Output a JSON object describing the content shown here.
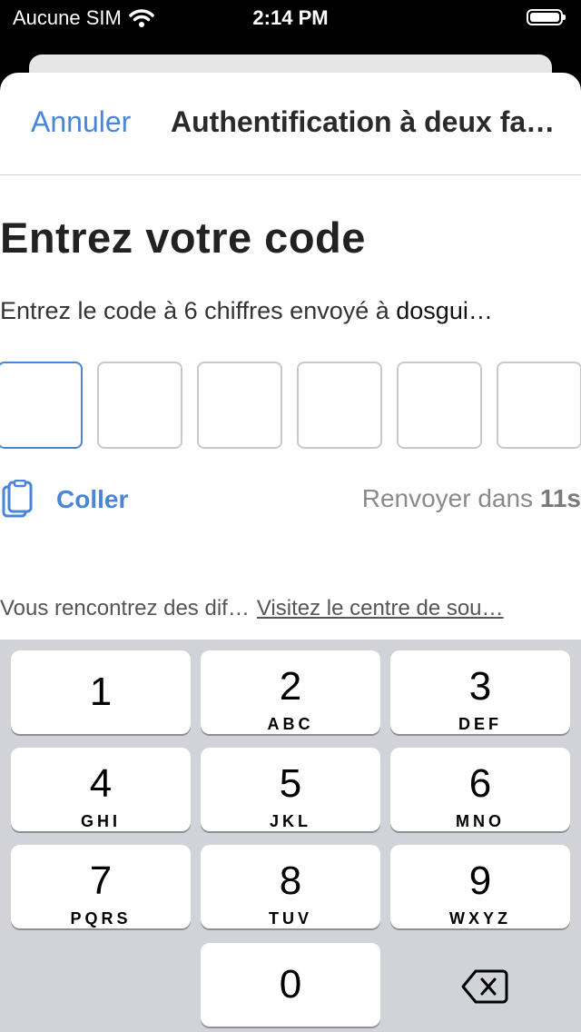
{
  "status_bar": {
    "carrier": "Aucune SIM",
    "time": "2:14 PM"
  },
  "nav": {
    "cancel_label": "Annuler",
    "title": "Authentification à deux facteurs"
  },
  "heading": "Entrez votre code",
  "subtitle": {
    "text": "Entrez le code à 6 chiffres envoyé à ",
    "email": "dosgui…"
  },
  "code_boxes": [
    "",
    "",
    "",
    "",
    "",
    ""
  ],
  "paste_label": "Coller",
  "resend": {
    "prefix": "Renvoyer dans ",
    "seconds": "11s"
  },
  "help": {
    "question": "Vous rencontrez des dif…",
    "link": "Visitez le centre de sou…"
  },
  "keypad": {
    "keys": [
      {
        "num": "1",
        "letters": ""
      },
      {
        "num": "2",
        "letters": "ABC"
      },
      {
        "num": "3",
        "letters": "DEF"
      },
      {
        "num": "4",
        "letters": "GHI"
      },
      {
        "num": "5",
        "letters": "JKL"
      },
      {
        "num": "6",
        "letters": "MNO"
      },
      {
        "num": "7",
        "letters": "PQRS"
      },
      {
        "num": "8",
        "letters": "TUV"
      },
      {
        "num": "9",
        "letters": "WXYZ"
      },
      {
        "num": "0",
        "letters": ""
      }
    ]
  },
  "colors": {
    "accent": "#4a86d8",
    "keypad_bg": "#d1d3d9"
  }
}
